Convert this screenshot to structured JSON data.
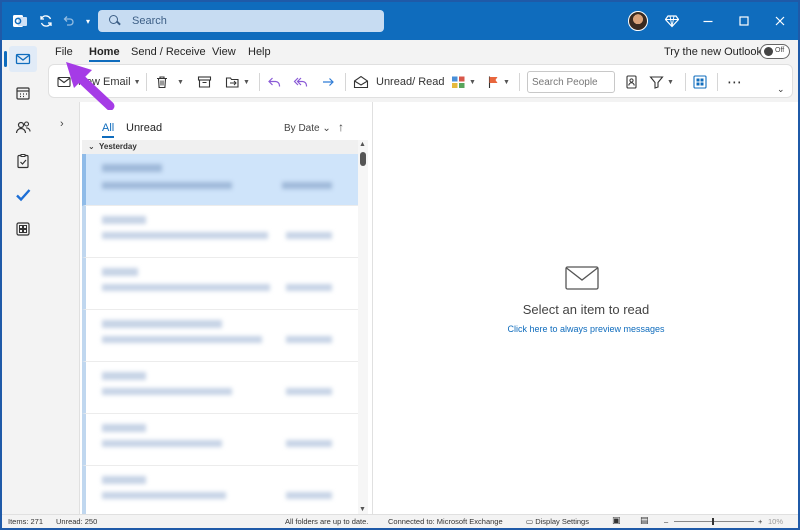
{
  "titlebar": {
    "search_placeholder": "Search"
  },
  "menu": {
    "tabs": [
      "File",
      "Home",
      "Send / Receive",
      "View",
      "Help"
    ],
    "active_tab": "Home",
    "try_new_outlook": "Try the new Outlook",
    "toggle_state": "Off"
  },
  "ribbon": {
    "new_email": "New Email",
    "unread_read": "Unread/ Read",
    "search_people_placeholder": "Search People"
  },
  "list": {
    "tab_all": "All",
    "tab_unread": "Unread",
    "sort": "By Date",
    "group_yesterday": "Yesterday"
  },
  "reading": {
    "title": "Select an item to read",
    "link": "Click here to always preview messages"
  },
  "status": {
    "items": "Items: 271",
    "unread": "Unread: 250",
    "sync": "All folders are up to date.",
    "connection": "Connected to: Microsoft Exchange",
    "display_settings": "Display Settings",
    "zoom": "10%"
  },
  "colors": {
    "accent": "#0f6cbd",
    "annotation": "#a53be6"
  }
}
